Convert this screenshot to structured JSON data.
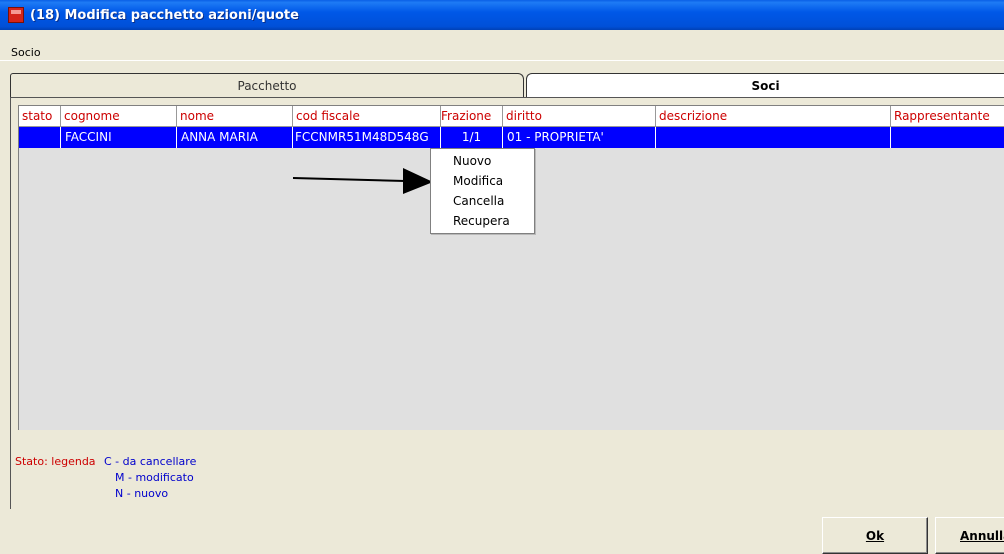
{
  "window": {
    "title": "(18) Modifica pacchetto azioni/quote"
  },
  "menu": {
    "items": [
      "Socio"
    ]
  },
  "tabs": [
    {
      "label": "Pacchetto",
      "active": false
    },
    {
      "label": "Soci",
      "active": true
    }
  ],
  "table": {
    "columns": [
      "stato",
      "cognome",
      "nome",
      "cod fiscale",
      "Frazione",
      "diritto",
      "descrizione",
      "Rappresentante"
    ],
    "rows": [
      {
        "stato": "",
        "cognome": "FACCINI",
        "nome": "ANNA MARIA",
        "cod_fiscale": "FCCNMR51M48D548G",
        "frazione": "1/1",
        "diritto": "01 - PROPRIETA'",
        "descrizione": "",
        "rappresentante": ""
      }
    ]
  },
  "context_menu": {
    "items": [
      "Nuovo",
      "Modifica",
      "Cancella",
      "Recupera"
    ]
  },
  "legend": {
    "label": "Stato: legenda",
    "items": [
      "C - da cancellare",
      "M - modificato",
      "N - nuovo"
    ]
  },
  "buttons": {
    "ok": "Ok",
    "annulla": "Annulla"
  },
  "colors": {
    "titlebar": "#0054E3",
    "selected_row": "#0000FF",
    "header_text": "#CC0000",
    "legend_label": "#CC0000",
    "legend_items": "#0000CC"
  }
}
